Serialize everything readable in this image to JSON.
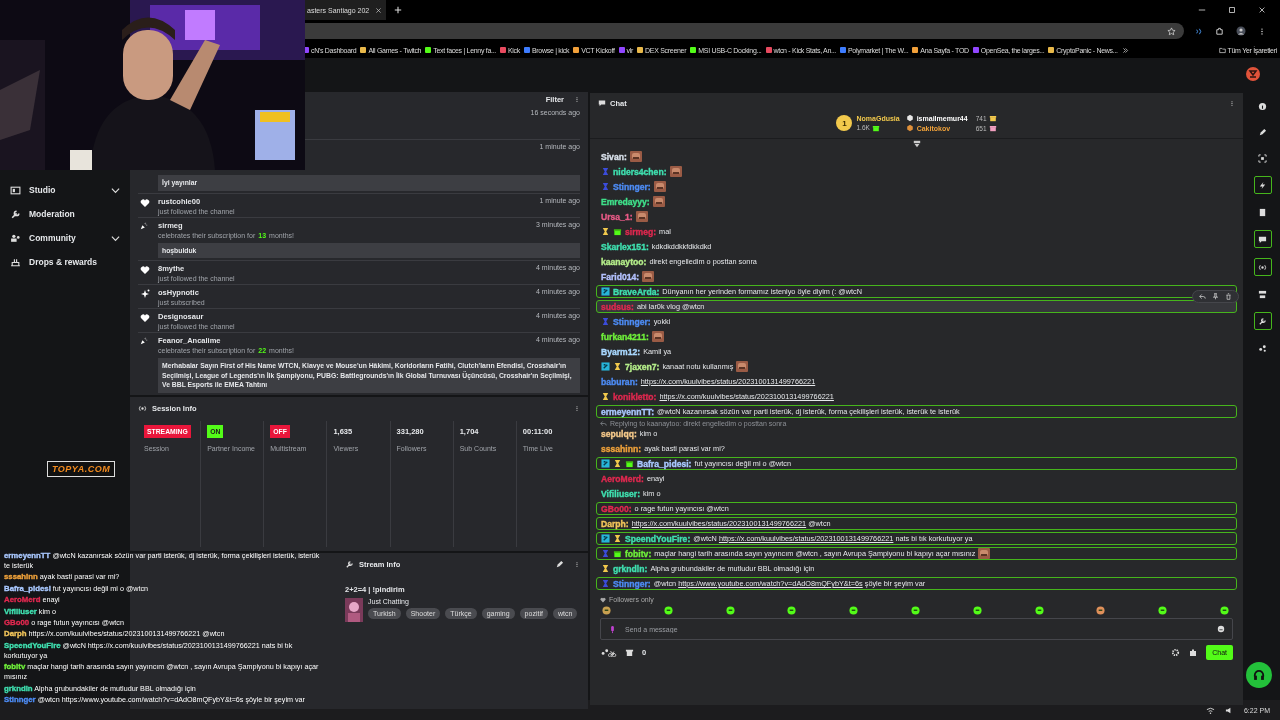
{
  "browser": {
    "tab_title": "asters Santiago 202",
    "bookmarks": [
      "cN's Dashboard",
      "All Games - Twitch",
      "Text faces | Lenny fa...",
      "Kick",
      "Browse | kick",
      "VCT Kickoff",
      "vlr",
      "DEX Screener",
      "MSI USB-C Docking...",
      "wtcn - Kick Stats, An...",
      "Polymarket | The W...",
      "Ana Sayfa - TOD",
      "OpenSea, the larges...",
      "CryptoPanic - News..."
    ],
    "all_bookmarks": "Tüm Yer İşaretleri"
  },
  "sidebar": {
    "items": [
      {
        "label": "Studio",
        "kind": "group",
        "expanded": false
      },
      {
        "label": "Moderation",
        "kind": "link"
      },
      {
        "label": "Community",
        "kind": "group",
        "expanded": false
      },
      {
        "label": "Drops & rewards",
        "kind": "link"
      }
    ]
  },
  "activity": {
    "filter": "Filter",
    "items": [
      {
        "kind": "hidden",
        "time": "16 seconds ago"
      },
      {
        "kind": "hidden",
        "time": "1 minute ago",
        "message": "İyi yayınlar"
      },
      {
        "kind": "follow",
        "user": "rustcohle00",
        "subtitle": "just followed the channel",
        "time": "1 minute ago"
      },
      {
        "kind": "resub",
        "user": "sirmeg",
        "subtitle": "celebrates their subscription for",
        "months": "13",
        "subtitle_end": "months!",
        "time": "3 minutes ago",
        "message": "hoşbulduk"
      },
      {
        "kind": "follow",
        "user": "8mythe",
        "subtitle": "just followed the channel",
        "time": "4 minutes ago"
      },
      {
        "kind": "subscribe",
        "user": "osHypnotic",
        "subtitle": "just subscribed",
        "time": "4 minutes ago"
      },
      {
        "kind": "follow",
        "user": "Designosaur",
        "subtitle": "just followed the channel",
        "time": "4 minutes ago"
      },
      {
        "kind": "resub",
        "user": "Feanor_Ancalime",
        "subtitle": "celebrates their subscription for",
        "months": "22",
        "subtitle_end": "months!",
        "time": "4 minutes ago",
        "message": "Merhabalar Sayın First of His Name WTCN, Klavye ve Mouse'un Hâkimi, Koridorların Fatihi, Clutch'ların Efendisi, Crosshair'ın Seçilmişi, League of Legends'ın İlk Şampiyonu, PUBG: Battlegrounds'ın İlk Global Turnuvası Üçüncüsü, Crosshair'ın Seçilmişi, Ve BBL Esports ile EMEA Tahtını"
      }
    ]
  },
  "session_info": {
    "title": "Session Info",
    "stats": [
      {
        "kind": "badge",
        "value": "STREAMING",
        "color": "#e9163b",
        "label": "Session"
      },
      {
        "kind": "badge",
        "value": "ON",
        "color": "#53fc18",
        "label": "Partner Income"
      },
      {
        "kind": "badge",
        "value": "OFF",
        "color": "#e9163b",
        "label": "Multistream"
      },
      {
        "kind": "number",
        "value": "1,635",
        "label": "Viewers"
      },
      {
        "kind": "number",
        "value": "331,280",
        "label": "Followers"
      },
      {
        "kind": "number",
        "value": "1,704",
        "label": "Sub Counts"
      },
      {
        "kind": "number",
        "value": "00:11:00",
        "label": "Time Live"
      }
    ]
  },
  "stream_info": {
    "title": "Stream Info",
    "stream_title": "2+2=4 | !pindirim",
    "category": "Just Chatting",
    "tags": [
      "Turkish",
      "Shooter",
      "Türkçe",
      "gaming",
      "pozitif",
      "wtcn"
    ]
  },
  "overlay_logo": "TOPYA.COM",
  "overlay_chat": [
    {
      "user": "ermeyennTT",
      "color": "#a9c8ff",
      "text": "@wtcN kazanırsak sözün var parti isterük, dj isterük, forma çekilişleri isterük, isterük te isterük"
    },
    {
      "user": "sssahinn",
      "color": "#f0a23a",
      "text": "ayak basti parasi var mi?"
    },
    {
      "user": "Bafra_pidesi",
      "color": "#a9c8ff",
      "text": "fut yayıncısı değil mi o @wtcn"
    },
    {
      "user": "AeroMerd",
      "color": "#e0284f",
      "text": "enayi"
    },
    {
      "user": "Vifiliuser",
      "color": "#3fe0b0",
      "text": "kim o"
    },
    {
      "user": "GBo00",
      "color": "#e0284f",
      "text": "o rage futun yayıncısı @wtcn"
    },
    {
      "user": "Darph",
      "color": "#f2c45a",
      "text": "https://x.com/kuulvibes/status/2023100131499766221 @wtcn"
    },
    {
      "user": "SpeendYouFire",
      "color": "#3fe0b0",
      "text": "@wtcN https://x.com/kuulvibes/status/2023100131499766221 nats bi tık korkutuyor ya"
    },
    {
      "user": "fobitv",
      "color": "#6ff03a",
      "text": "maçlar hangi tarih arasında sayın yayıncım @wtcn , sayın Avrupa Şampiyonu bi kapıyı açar mısınız"
    },
    {
      "user": "grkndln",
      "color": "#3fe0b0",
      "text": "Alpha grubundakiler de mutludur BBL olmadığı için"
    },
    {
      "user": "Stinnger",
      "color": "#4d8cf5",
      "text": "@wtcn https://www.youtube.com/watch?v=dAdO8mQFybY&t=6s şöyle bir şeyim var"
    }
  ],
  "chat": {
    "title": "Chat",
    "leaders": [
      {
        "kind": "top",
        "rank": "1",
        "name": "NomaGdusia",
        "amount": "1.6K",
        "color": "#f2c94c"
      },
      {
        "kind": "runner",
        "name": "ismailmemur44",
        "amount": "741",
        "color": "#ffffff"
      },
      {
        "kind": "runner",
        "name": "Cakitokov",
        "amount": "651",
        "color": "#f0a23a"
      }
    ],
    "messages": [
      {
        "user": "Sivan:",
        "color": "#d8e0ea",
        "emote": true,
        "highlighted": false,
        "hovered": false
      },
      {
        "user": "niders4chen:",
        "color": "#3fe0b0",
        "badges": [
          {
            "kind": "founder"
          }
        ],
        "emote": true,
        "highlighted": false,
        "hovered": false
      },
      {
        "user": "Stinnger:",
        "color": "#4d8cf5",
        "badges": [
          {
            "kind": "founder"
          }
        ],
        "emote": true,
        "highlighted": false,
        "hovered": false
      },
      {
        "user": "Emredayyy:",
        "color": "#3fe08a",
        "emote": true,
        "highlighted": false,
        "hovered": false
      },
      {
        "user": "Ursa_1:",
        "color": "#e85a86",
        "emote": true,
        "highlighted": false,
        "hovered": false
      },
      {
        "user": "sirmeg:",
        "color": "#e0284f",
        "badges": [
          {
            "kind": "sub"
          },
          {
            "kind": "gift"
          }
        ],
        "text": "mal",
        "emote": false,
        "highlighted": false,
        "hovered": false
      },
      {
        "user": "Skarlex151:",
        "color": "#3fe0b0",
        "text": "kdkdkddkkfdkkdkd",
        "emote": false,
        "highlighted": false,
        "hovered": false
      },
      {
        "user": "kaanaytoo:",
        "color": "#b5ee8a",
        "text": "direkt engelledim o posttan sonra",
        "emote": false,
        "highlighted": false,
        "hovered": false
      },
      {
        "user": "Farid014:",
        "color": "#b4c2ff",
        "emote": true,
        "highlighted": false,
        "hovered": false
      },
      {
        "user": "BraveArda:",
        "color": "#3fe0b0",
        "badges": [
          {
            "kind": "og"
          }
        ],
        "text": "Dünyanın her yerinden formamız isteniyo öyle diyim (: @wtcN",
        "emote": false,
        "highlighted": true,
        "hovered": false
      },
      {
        "user": "sudsus:",
        "color": "#e0284f",
        "text": "abi lar0k vlog @wtcn",
        "emote": false,
        "highlighted": true,
        "hovered": true
      },
      {
        "user": "Stinnger:",
        "color": "#4d8cf5",
        "badges": [
          {
            "kind": "founder"
          }
        ],
        "text": "yokki",
        "emote": false,
        "highlighted": false,
        "hovered": false
      },
      {
        "user": "furkan4211:",
        "color": "#6ff03a",
        "emote": true,
        "highlighted": false,
        "hovered": false
      },
      {
        "user": "Byarm12:",
        "color": "#a9d8ff",
        "text": "Kamil ya",
        "emote": false,
        "highlighted": false,
        "hovered": false
      },
      {
        "user": "7jaxen7:",
        "color": "#b5ee8a",
        "badges": [
          {
            "kind": "og"
          },
          {
            "kind": "sub"
          }
        ],
        "text": "kanaat notu kullanmış",
        "emote": true,
        "highlighted": false,
        "hovered": false
      },
      {
        "user": "baburan:",
        "color": "#4d8cf5",
        "parts": [
          {
            "kind": "link",
            "text": "https://x.com/kuulvibes/status/2023100131499766221"
          }
        ],
        "emote": false,
        "highlighted": false,
        "hovered": false
      },
      {
        "user": "konikletto:",
        "color": "#e0284f",
        "badges": [
          {
            "kind": "sub"
          }
        ],
        "parts": [
          {
            "kind": "link",
            "text": "https://x.com/kuulvibes/status/2023100131499766221"
          }
        ],
        "emote": false,
        "highlighted": false,
        "hovered": false
      },
      {
        "user": "ermeyennTT:",
        "color": "#a9c8ff",
        "text": "@wtcN kazanırsak sözün var parti isterük, dj isterük, forma çekilişleri isterük, isterük te isterük",
        "emote": false,
        "highlighted": true,
        "hovered": false
      },
      {
        "user": "sepulqq:",
        "color": "#f5c98a",
        "reply": "Replying to kaanaytoo: direkt engelledim o posttan sonra",
        "text": "kim o",
        "emote": false,
        "highlighted": false,
        "hovered": false
      },
      {
        "user": "sssahinn:",
        "color": "#f0a23a",
        "text": "ayak basti parasi var mi?",
        "emote": false,
        "highlighted": false,
        "hovered": false
      },
      {
        "user": "Bafra_pidesi:",
        "color": "#a9c8ff",
        "badges": [
          {
            "kind": "og"
          },
          {
            "kind": "sub"
          },
          {
            "kind": "gift"
          }
        ],
        "text": "fut yayıncısı değil mi o @wtcn",
        "emote": false,
        "highlighted": true,
        "hovered": false
      },
      {
        "user": "AeroMerd:",
        "color": "#e0284f",
        "text": "enayi",
        "emote": false,
        "highlighted": false,
        "hovered": false
      },
      {
        "user": "Vifiliuser:",
        "color": "#3fe0b0",
        "text": "kim o",
        "emote": false,
        "highlighted": false,
        "hovered": false
      },
      {
        "user": "GBo00:",
        "color": "#e0284f",
        "text": "o rage futun yayıncısı @wtcn",
        "emote": false,
        "highlighted": true,
        "hovered": false
      },
      {
        "user": "Darph:",
        "color": "#f2c45a",
        "parts": [
          {
            "kind": "link",
            "text": "https://x.com/kuulvibes/status/2023100131499766221"
          },
          {
            "kind": "text",
            "text": " @wtcn"
          }
        ],
        "emote": false,
        "highlighted": true,
        "hovered": false
      },
      {
        "user": "SpeendYouFire:",
        "color": "#3fe0b0",
        "badges": [
          {
            "kind": "og"
          },
          {
            "kind": "sub"
          }
        ],
        "parts": [
          {
            "kind": "text",
            "text": "@wtcN "
          },
          {
            "kind": "link",
            "text": "https://x.com/kuulvibes/status/2023100131499766221"
          },
          {
            "kind": "text",
            "text": " nats bi tık korkutuyor ya"
          }
        ],
        "emote": false,
        "highlighted": true,
        "hovered": false
      },
      {
        "user": "fobitv:",
        "color": "#6ff03a",
        "badges": [
          {
            "kind": "founder"
          },
          {
            "kind": "gift"
          }
        ],
        "text": "maçlar hangi tarih arasında sayın yayıncım @wtcn , sayın Avrupa Şampiyonu bi kapıyı açar mısınız",
        "emote": true,
        "highlighted": true,
        "hovered": false
      },
      {
        "user": "grkndln:",
        "color": "#3fe0b0",
        "badges": [
          {
            "kind": "sub"
          }
        ],
        "text": "Alpha grubundakiler de mutludur BBL olmadığı için",
        "emote": false,
        "highlighted": false,
        "hovered": false
      },
      {
        "user": "Stinnger:",
        "color": "#4d8cf5",
        "badges": [
          {
            "kind": "founder"
          }
        ],
        "parts": [
          {
            "kind": "text",
            "text": "@wtcn "
          },
          {
            "kind": "link",
            "text": "https://www.youtube.com/watch?v=dAdO8mQFybY&t=6s"
          },
          {
            "kind": "text",
            "text": " şöyle bir şeyim var"
          }
        ],
        "emote": false,
        "highlighted": true,
        "hovered": false
      }
    ],
    "followers_only": "Followers only",
    "placeholder": "Send a message",
    "points": "0",
    "send": "Chat"
  },
  "taskbar": {
    "time": "6:22 PM"
  }
}
